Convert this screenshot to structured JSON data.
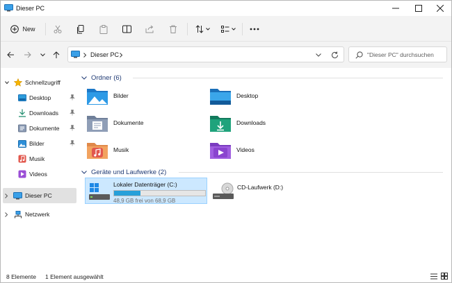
{
  "window": {
    "title": "Dieser PC"
  },
  "toolbar": {
    "new_label": "New"
  },
  "address": {
    "crumbs": [
      "Dieser PC"
    ]
  },
  "search": {
    "placeholder": "\"Dieser PC\" durchsuchen"
  },
  "sidebar": {
    "quick_access": "Schnellzugriff",
    "items": [
      {
        "label": "Desktop",
        "pinned": true
      },
      {
        "label": "Downloads",
        "pinned": true
      },
      {
        "label": "Dokumente",
        "pinned": true
      },
      {
        "label": "Bilder",
        "pinned": true
      },
      {
        "label": "Musik",
        "pinned": false
      },
      {
        "label": "Videos",
        "pinned": false
      }
    ],
    "this_pc": "Dieser PC",
    "network": "Netzwerk"
  },
  "main": {
    "folders_header": "Ordner (6)",
    "folders": [
      {
        "name": "Bilder",
        "icon": "pictures-folder-icon"
      },
      {
        "name": "Desktop",
        "icon": "desktop-folder-icon"
      },
      {
        "name": "Dokumente",
        "icon": "documents-folder-icon"
      },
      {
        "name": "Downloads",
        "icon": "downloads-folder-icon"
      },
      {
        "name": "Musik",
        "icon": "music-folder-icon"
      },
      {
        "name": "Videos",
        "icon": "videos-folder-icon"
      }
    ],
    "drives_header": "Geräte und Laufwerke (2)",
    "drives": [
      {
        "name": "Lokaler Datenträger (C:)",
        "free_text": "48,9 GB frei von 68,9 GB",
        "used_fraction": 0.29,
        "selected": true
      },
      {
        "name": "CD-Laufwerk (D:)",
        "selected": false
      }
    ]
  },
  "status": {
    "count": "8 Elemente",
    "selection": "1 Element ausgewählt"
  },
  "colors": {
    "accent": "#0078d4",
    "selection": "#cce8ff",
    "group_header": "#1f3a74",
    "drive_bar": "#26a0da"
  }
}
